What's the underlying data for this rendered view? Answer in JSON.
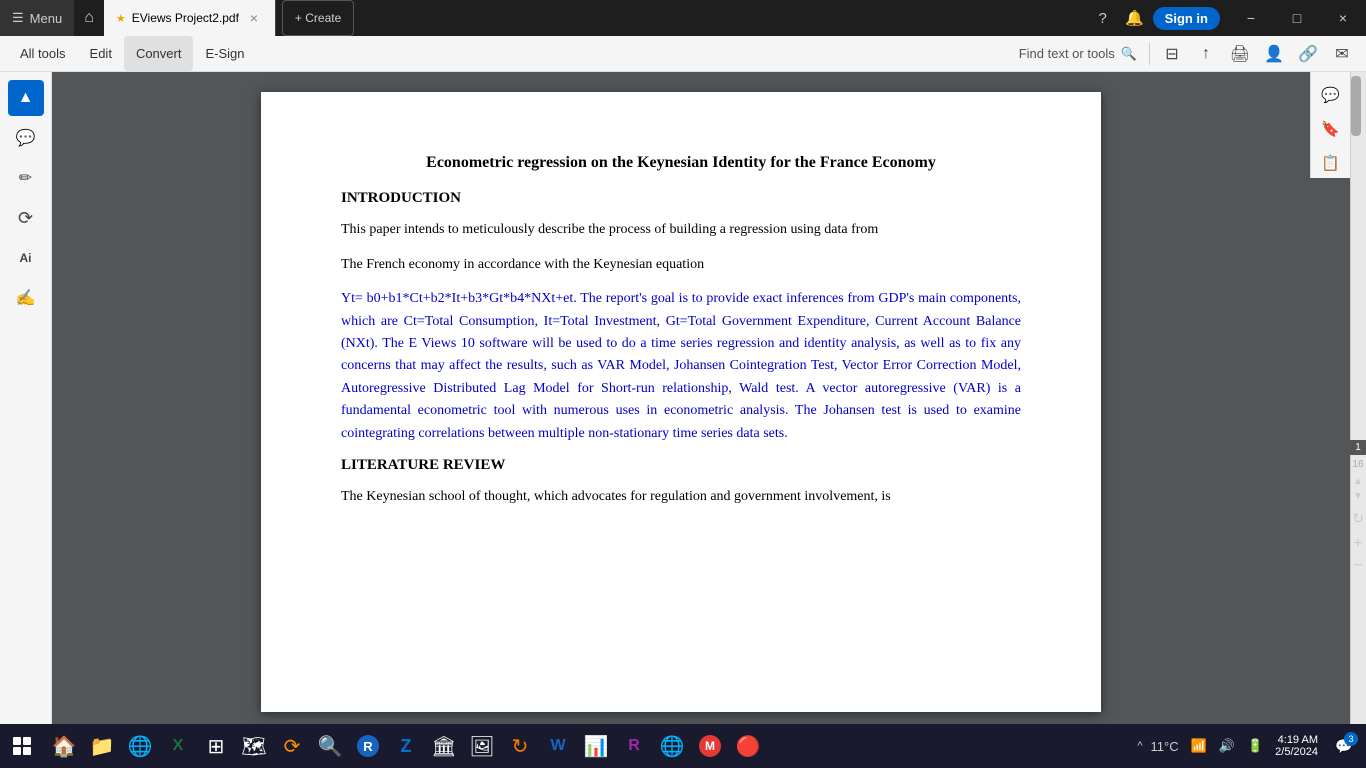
{
  "titlebar": {
    "menu_label": "Menu",
    "home_icon": "⌂",
    "tab": {
      "star": "★",
      "filename": "EViews Project2.pdf",
      "close": "×"
    },
    "create_label": "+ Create",
    "help_icon": "?",
    "bell_icon": "🔔",
    "signin_label": "Sign in",
    "minimize": "−",
    "maximize": "□",
    "close": "×"
  },
  "menubar": {
    "items": [
      "All tools",
      "Edit",
      "Convert",
      "E-Sign"
    ],
    "find_text": "Find text or tools",
    "search_icon": "🔍"
  },
  "toolbar_icons": [
    "⊟",
    "↑",
    "🖨",
    "👤",
    "🔗",
    "✉"
  ],
  "left_sidebar": {
    "tools": [
      "▲",
      "💬",
      "✏",
      "⟳",
      "Ai",
      "✍"
    ]
  },
  "pdf": {
    "title": "Econometric regression on the Keynesian Identity for the France Economy",
    "intro_heading": "INTRODUCTION",
    "para1": "This paper intends to meticulously describe the process of building a regression using data from",
    "para2": "The French economy in accordance with the Keynesian equation",
    "para3": "Yt= b0+b1*Ct+b2*It+b3*Gt*b4*NXt+et. The report's goal is to provide exact inferences from GDP's main components, which are Ct=Total Consumption, It=Total Investment, Gt=Total Government Expenditure, Current Account Balance (NXt). The E Views 10 software will be used to do a time series regression and identity analysis, as well as to fix any concerns that may affect the results, such as VAR Model, Johansen Cointegration Test, Vector Error Correction Model, Autoregressive Distributed Lag Model for Short-run relationship, Wald test. A vector autoregressive (VAR) is a fundamental econometric tool with numerous uses in econometric analysis. The Johansen test is used to examine cointegrating correlations between multiple non-stationary time series data sets.",
    "lit_heading": "LITERATURE REVIEW",
    "lit_para": "The Keynesian school of thought, which advocates for regulation and government involvement, is"
  },
  "right_sidebar_icons": [
    "💬",
    "🔖",
    "📋"
  ],
  "page_indicator": {
    "current": "1",
    "total": "16"
  },
  "taskbar": {
    "start_icon": "⊞",
    "icons": [
      "🏠",
      "📁",
      "🌐",
      "📊",
      "⊞",
      "🗺",
      "⟳",
      "🔍",
      "R",
      "Z",
      "🏛",
      "🖼",
      "⟳",
      "W",
      "📊",
      "R",
      "🌐",
      "M",
      "🔴"
    ],
    "sys_icons": [
      "^",
      "🔊",
      "📶",
      "🔋"
    ],
    "temp": "11°C",
    "time": "4:19 AM",
    "date": "2/5/2024",
    "notify_count": "3"
  }
}
